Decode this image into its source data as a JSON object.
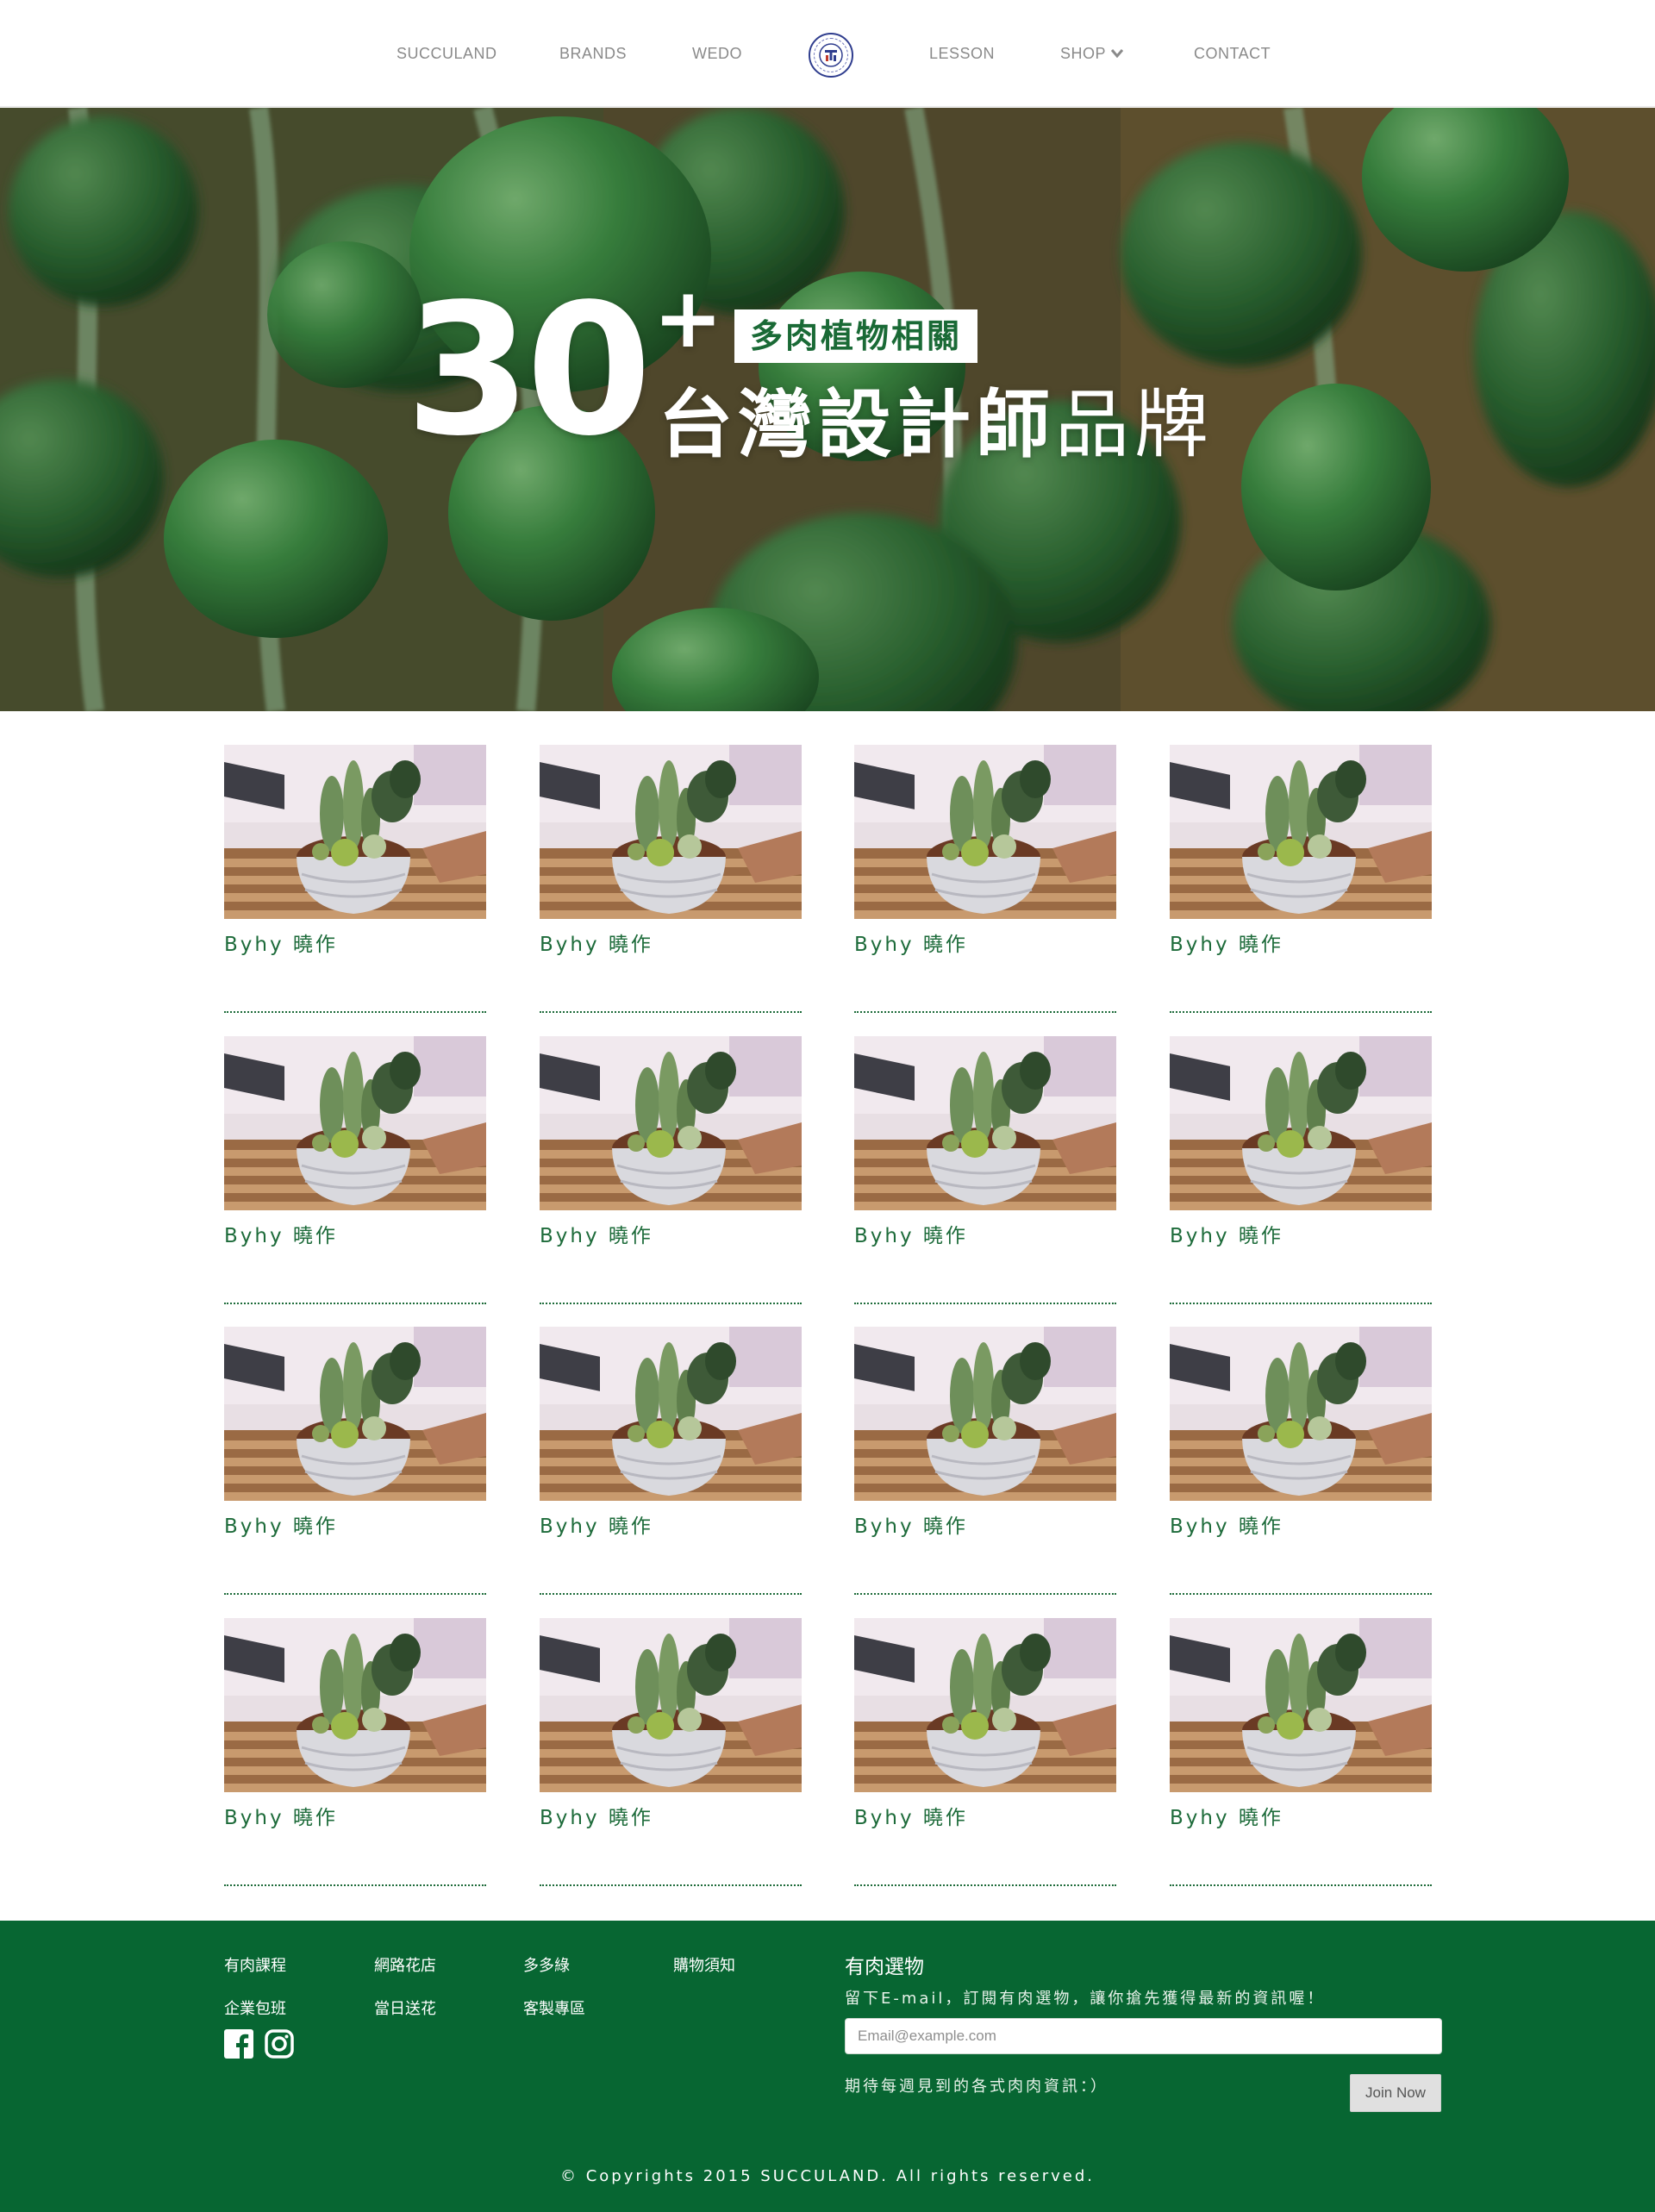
{
  "nav": {
    "items": [
      {
        "label": "SUCCULAND"
      },
      {
        "label": "BRANDS"
      },
      {
        "label": "WEDO"
      },
      {
        "label": "LESSON"
      },
      {
        "label": "SHOP"
      },
      {
        "label": "CONTACT"
      }
    ],
    "logo_icon": "circular-seal-logo",
    "shop_icon": "chevron-down-icon"
  },
  "hero": {
    "number": "30",
    "plus": "+",
    "badge": "多肉植物相關",
    "line_bold": "台灣設計師",
    "line_light": "品牌"
  },
  "grid": {
    "items": [
      {
        "title": "Byhy 曉作"
      },
      {
        "title": "Byhy 曉作"
      },
      {
        "title": "Byhy 曉作"
      },
      {
        "title": "Byhy 曉作"
      },
      {
        "title": "Byhy 曉作"
      },
      {
        "title": "Byhy 曉作"
      },
      {
        "title": "Byhy 曉作"
      },
      {
        "title": "Byhy 曉作"
      },
      {
        "title": "Byhy 曉作"
      },
      {
        "title": "Byhy 曉作"
      },
      {
        "title": "Byhy 曉作"
      },
      {
        "title": "Byhy 曉作"
      },
      {
        "title": "Byhy 曉作"
      },
      {
        "title": "Byhy 曉作"
      },
      {
        "title": "Byhy 曉作"
      },
      {
        "title": "Byhy 曉作"
      }
    ]
  },
  "footer": {
    "links": [
      {
        "label": "有肉課程"
      },
      {
        "label": "網路花店"
      },
      {
        "label": "多多綠"
      },
      {
        "label": "購物須知"
      },
      {
        "label": "企業包班"
      },
      {
        "label": "當日送花"
      },
      {
        "label": "客製專區"
      }
    ],
    "social": [
      "facebook-icon",
      "instagram-icon"
    ],
    "newsletter_title": "有肉選物",
    "newsletter_desc": "留下E-mail，訂閱有肉選物，讓你搶先獲得最新的資訊喔！",
    "email_placeholder": "Email@example.com",
    "newsletter_note": "期待每週見到的各式肉肉資訊：）",
    "join_label": "Join Now",
    "copyright": "© Copyrights 2015 SUCCULAND. All rights reserved."
  },
  "colors": {
    "brand_green": "#076632",
    "title_green": "#1d6b3a",
    "nav_text": "#8a8a8a"
  }
}
